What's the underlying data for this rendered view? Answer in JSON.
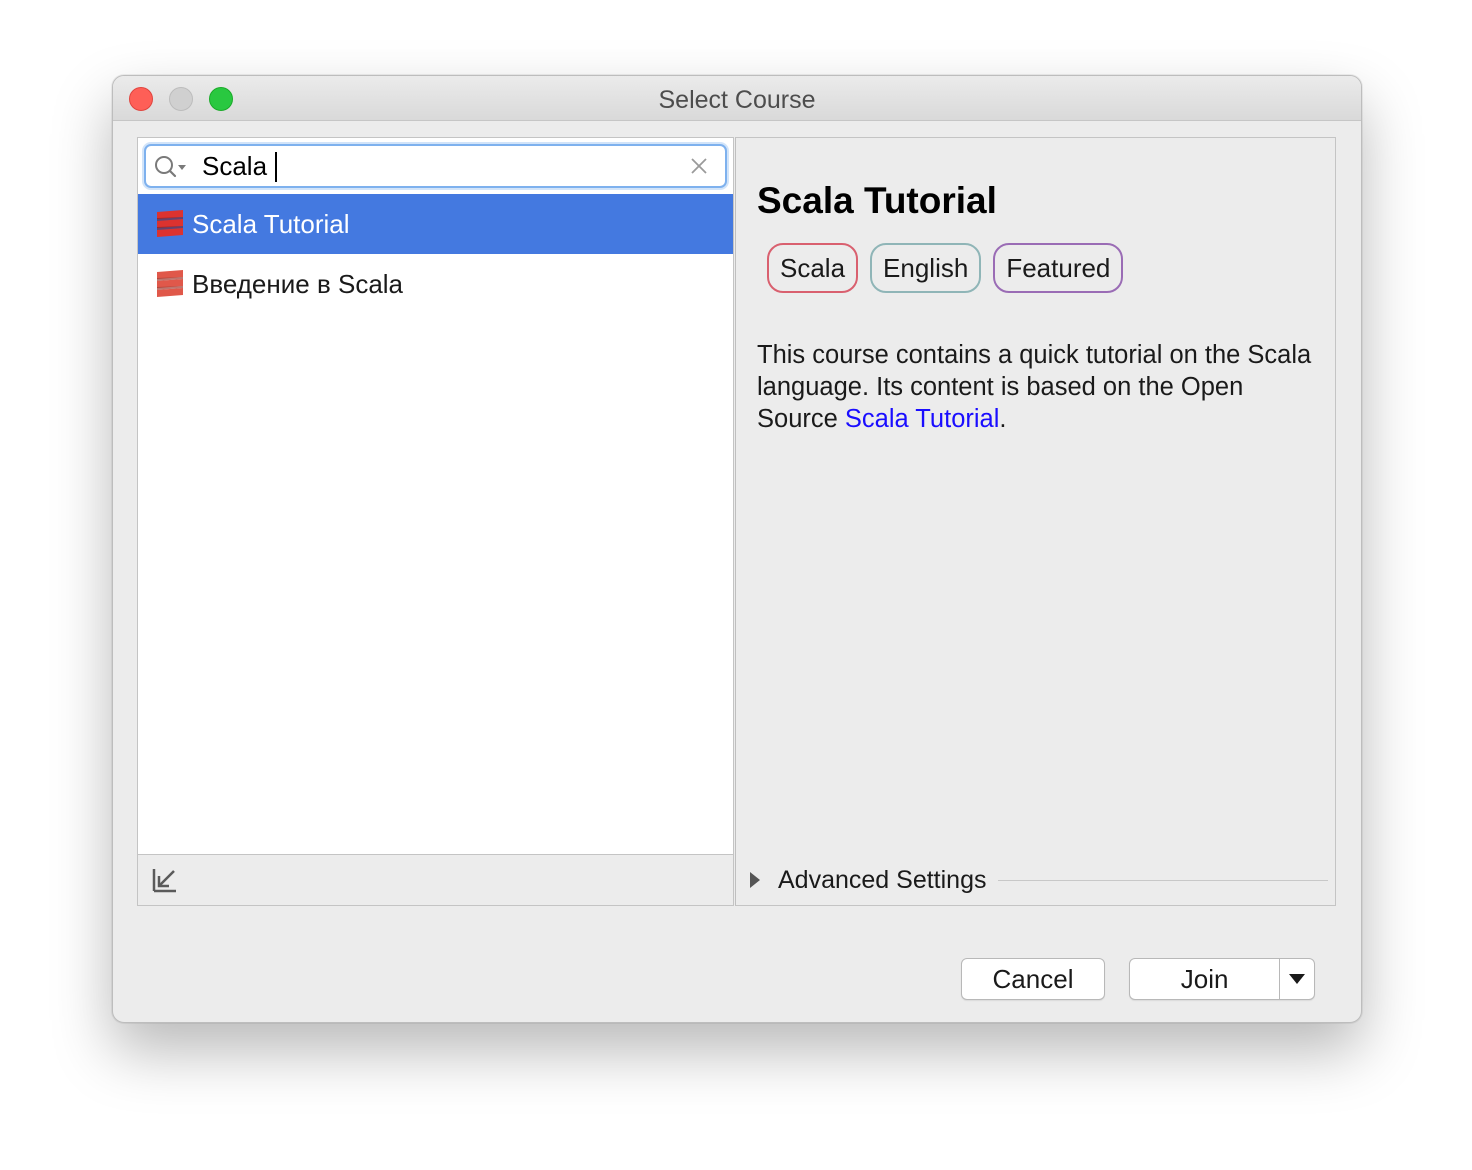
{
  "window": {
    "title": "Select Course"
  },
  "search": {
    "value": "Scala",
    "icon": "search-icon",
    "clear_icon": "clear-icon"
  },
  "courses": [
    {
      "name": "Scala Tutorial",
      "icon": "scala-logo-icon",
      "selected": true
    },
    {
      "name": "Введение в Scala",
      "icon": "scala-logo-icon",
      "selected": false
    }
  ],
  "details": {
    "title": "Scala Tutorial",
    "tags": [
      "Scala",
      "English",
      "Featured"
    ],
    "tag_colors": [
      "#d9606f",
      "#8fb5b7",
      "#9a6cb5"
    ],
    "description_prefix": "This course contains a quick tutorial on the Scala language. Its content is based on the Open Source ",
    "description_link": "Scala Tutorial",
    "description_suffix": ".",
    "advanced_settings": "Advanced Settings"
  },
  "buttons": {
    "cancel": "Cancel",
    "join": "Join"
  },
  "colors": {
    "selection": "#4479e0",
    "link": "#1a0dff",
    "close": "#fe5f57",
    "maximize": "#29c840"
  }
}
